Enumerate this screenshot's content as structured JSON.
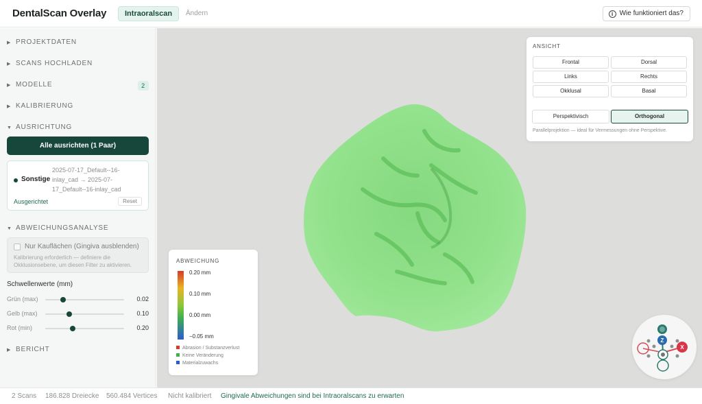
{
  "header": {
    "app_title": "DentalScan Overlay",
    "mode_tab": "Intraoralscan",
    "mode_change": "Ändern",
    "help_label": "Wie funktioniert das?"
  },
  "sidebar": {
    "sections": {
      "projektdaten": "PROJEKTDATEN",
      "scans": "SCANS HOCHLADEN",
      "modelle": "MODELLE",
      "modelle_badge": "2",
      "kalibrierung": "KALIBRIERUNG",
      "ausrichtung": "AUSRICHTUNG",
      "abweichung": "ABWEICHUNGSANALYSE",
      "bericht": "BERICHT"
    },
    "align_button": "Alle ausrichten (1 Paar)",
    "pair": {
      "tag": "Sonstige",
      "names": "2025-07-17_Default--16-inlay_cad → 2025-07-17_Default--16-inlay_cad",
      "status": "Ausgerichtet",
      "reset": "Reset"
    },
    "filter": {
      "label": "Nur Kauflächen (Gingiva ausblenden)",
      "help": "Kalibrierung erforderlich — definiere die Okklusionsebene, um diesen Filter zu aktivieren.",
      "checked": false
    },
    "thresholds": {
      "title": "Schwellenwerte (mm)",
      "rows": [
        {
          "label": "Grün (max)",
          "value": "0.02",
          "fraction": 0.23
        },
        {
          "label": "Gelb (max)",
          "value": "0.10",
          "fraction": 0.3
        },
        {
          "label": "Rot (min)",
          "value": "0.20",
          "fraction": 0.35
        }
      ]
    }
  },
  "view_panel": {
    "title": "ANSICHT",
    "buttons": [
      "Frontal",
      "Dorsal",
      "Links",
      "Rechts",
      "Okklusal",
      "Basal"
    ],
    "projection": {
      "perspective": "Perspektivisch",
      "orthogonal": "Orthogonal",
      "active": "Orthogonal"
    },
    "hint": "Parallelprojektion — ideal für Vermessungen ohne Perspektive."
  },
  "legend": {
    "title": "ABWEICHUNG",
    "ticks": [
      "0.20 mm",
      "0.10 mm",
      "0.00 mm",
      "−0.05 mm"
    ],
    "items": [
      {
        "label": "Abrasion / Substanzverlust",
        "color": "#d83a2b"
      },
      {
        "label": "Keine Veränderung",
        "color": "#3fb04e"
      },
      {
        "label": "Materialzuwachs",
        "color": "#2d5bd0"
      }
    ]
  },
  "gizmo": {
    "x_label": "X",
    "z_label": "Z"
  },
  "status": {
    "scans": "2 Scans",
    "triangles": "186.828 Dreiecke",
    "vertices": "560.484 Vertices",
    "calibration": "Nicht kalibriert",
    "note": "Gingivale Abweichungen sind bei Intraoralscans zu erwarten"
  },
  "colors": {
    "accent": "#17473b",
    "tooth": "#8fe08a"
  }
}
